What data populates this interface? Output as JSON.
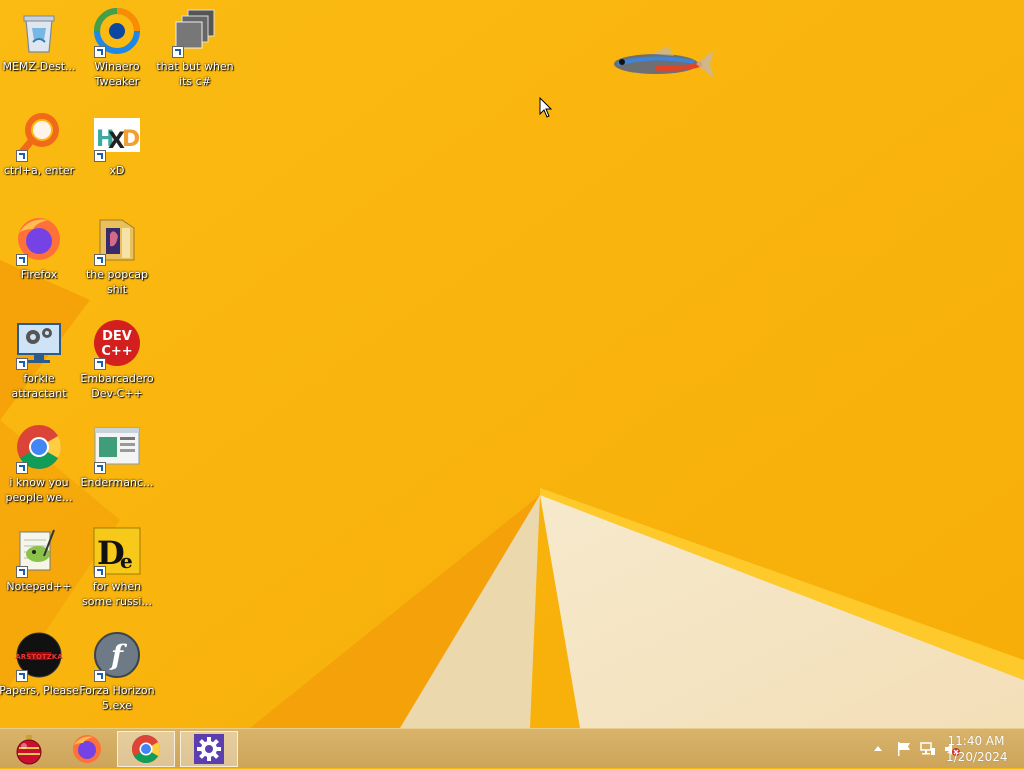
{
  "desktop": {
    "icons": [
      {
        "label": "MEMZ-Dest...",
        "icon": "recycle-bin-icon",
        "shortcut": false
      },
      {
        "label": "Winaero Tweaker",
        "icon": "winaero-tweaker-icon",
        "shortcut": true
      },
      {
        "label": "that but when its c#",
        "icon": "stacked-windows-icon",
        "shortcut": true
      },
      {
        "label": "ctrl+a, enter",
        "icon": "magnifier-icon",
        "shortcut": true
      },
      {
        "label": "xD",
        "icon": "hxd-icon",
        "shortcut": true
      },
      {
        "label": "Firefox",
        "icon": "firefox-icon",
        "shortcut": true
      },
      {
        "label": "the popcap shit",
        "icon": "folder-icon",
        "shortcut": true
      },
      {
        "label": "forkie attractant",
        "icon": "gear-monitor-icon",
        "shortcut": true
      },
      {
        "label": "Embarcadero Dev-C++",
        "icon": "devcpp-icon",
        "shortcut": true
      },
      {
        "label": "i know you people we...",
        "icon": "chrome-icon",
        "shortcut": true
      },
      {
        "label": "Endermanc...",
        "icon": "window-app-icon",
        "shortcut": true
      },
      {
        "label": "Notepad++",
        "icon": "notepadpp-icon",
        "shortcut": true
      },
      {
        "label": "for when some russi...",
        "icon": "de-icon",
        "shortcut": true
      },
      {
        "label": "Papers, Please",
        "icon": "papers-please-icon",
        "shortcut": true
      },
      {
        "label": "Forza Horizon 5.exe",
        "icon": "flash-icon",
        "shortcut": true
      }
    ]
  },
  "taskbar": {
    "buttons": [
      {
        "name": "ornament-app-button",
        "icon": "ornament-icon",
        "active": false
      },
      {
        "name": "firefox-taskbar-button",
        "icon": "firefox-icon",
        "active": false
      },
      {
        "name": "chrome-taskbar-button",
        "icon": "chrome-icon",
        "active": true
      },
      {
        "name": "settings-taskbar-button",
        "icon": "gear-icon",
        "active": true
      }
    ],
    "tray": {
      "icons": [
        "chevron-up-icon",
        "flag-icon",
        "network-icon",
        "volume-muted-icon"
      ],
      "time": "11:40 AM",
      "date": "1/20/2024"
    }
  },
  "colors": {
    "wallpaper": "#f9b90e",
    "taskbar": "#d1aa5f"
  }
}
